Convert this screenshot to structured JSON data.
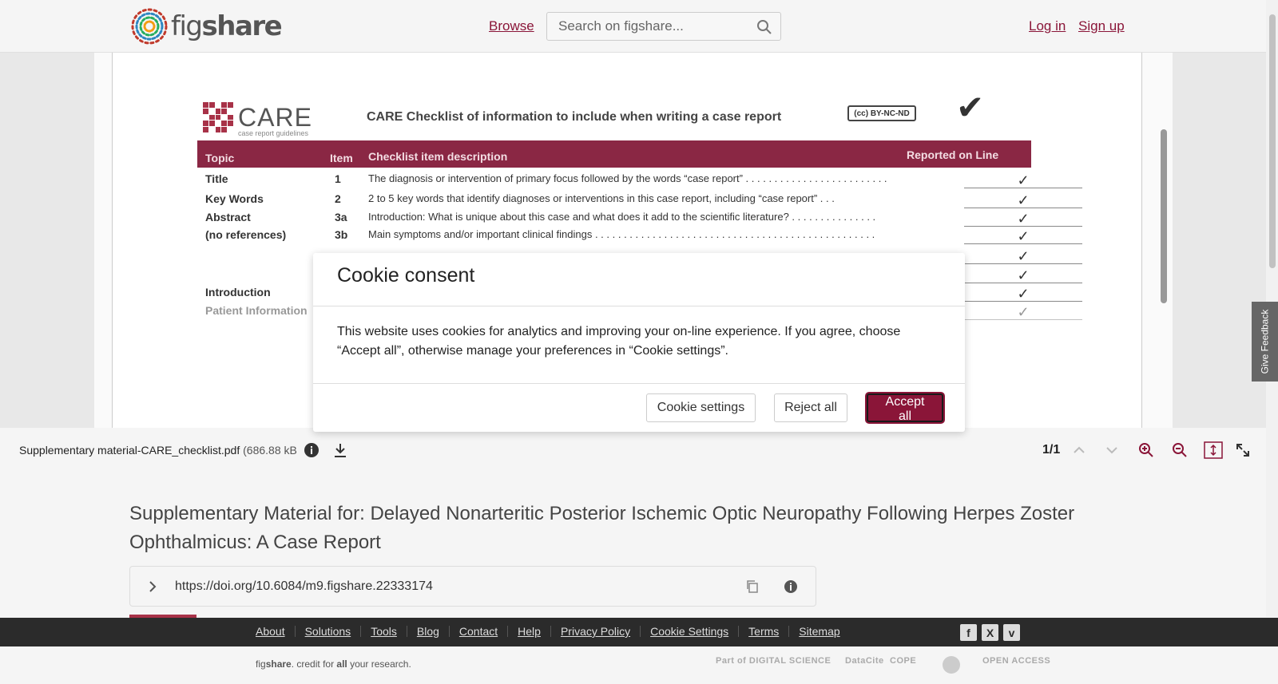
{
  "header": {
    "logo_text_fig": "fig",
    "logo_text_share": "share",
    "browse": "Browse",
    "search_placeholder": "Search on figshare...",
    "login": "Log in",
    "signup": "Sign up"
  },
  "document": {
    "care_word": "CARE",
    "care_sub": "case report guidelines",
    "title": "CARE Checklist of information to include when writing a case report",
    "cc_badge": "(cc) BY-NC-ND",
    "columns": [
      "Topic",
      "Item",
      "Checklist item description",
      "Reported on Line"
    ],
    "rows": [
      {
        "topic": "Title",
        "item": "1",
        "desc": "The diagnosis or intervention of primary focus followed by the words “case report” . . . . . . . . . . . . . . . . . . . . . . . . .",
        "check": "✓"
      },
      {
        "topic": "Key Words",
        "item": "2",
        "desc": "2 to 5 key words that identify diagnoses or interventions in this case report, including “case report” . . .",
        "check": "✓"
      },
      {
        "topic": "Abstract",
        "item": "3a",
        "desc": "Introduction: What is unique about this case and what does it add to the scientific literature? . . . . . . . . . . . . . . .",
        "check": "✓"
      },
      {
        "topic": "(no references)",
        "item": "3b",
        "desc": "Main symptoms and/or important clinical findings . . . . . . . . . . . . . . . . . . . . . . . . . . . . . . . . . . . . . . . . . . . . . . . . .",
        "check": "✓"
      },
      {
        "topic": "",
        "item": "",
        "desc": "",
        "check": "✓"
      },
      {
        "topic": "",
        "item": "",
        "desc": "",
        "check": "✓"
      },
      {
        "topic": "Introduction",
        "item": "",
        "desc": "",
        "check": "✓"
      },
      {
        "topic": "Patient Information",
        "item": "",
        "desc": "",
        "check": "✓"
      }
    ]
  },
  "toolbar": {
    "file_name": "Supplementary material-CARE_checklist.pdf",
    "file_size": "(686.88 kB",
    "page_count": "1/1"
  },
  "feedback": "Give Feedback",
  "article": {
    "title": "Supplementary Material for: Delayed Nonarteritic Posterior Ischemic Optic Neuropathy Following Herpes Zoster Ophthalmicus: A Case Report",
    "doi": "https://doi.org/10.6084/m9.figshare.22333174"
  },
  "footer": {
    "links": [
      "About",
      "Solutions",
      "Tools",
      "Blog",
      "Contact",
      "Help",
      "Privacy Policy",
      "Cookie Settings",
      "Terms",
      "Sitemap"
    ],
    "social": [
      "f",
      "X",
      "v"
    ],
    "tagline_fig": "fig",
    "tagline_share": "share",
    "tagline_rest1": ". credit for ",
    "tagline_all": "all",
    "tagline_rest2": " your research.",
    "partners": [
      "Part of DIGITAL SCIENCE",
      "DataCite",
      "COPE",
      "",
      "OPEN ACCESS"
    ]
  },
  "cookie": {
    "title": "Cookie consent",
    "body": "This website uses cookies for analytics and improving your on-line experience. If you agree, choose “Accept all”, otherwise manage your preferences in “Cookie settings”.",
    "settings": "Cookie settings",
    "reject": "Reject all",
    "accept": "Accept all"
  },
  "colors": {
    "brand": "#8a1538",
    "table_header": "#8a2744",
    "footer_bg": "#2b2b2b"
  }
}
